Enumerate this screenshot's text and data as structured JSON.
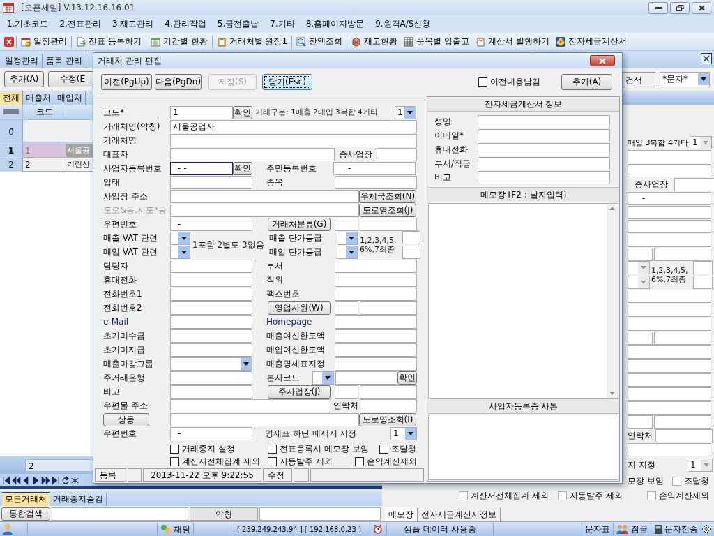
{
  "app": {
    "title": "[오픈세일] V.13.12.16.16.01"
  },
  "menu": [
    "1.기초코드",
    "2.전표관리",
    "3.재고관리",
    "4.관리작업",
    "5.금전출납",
    "7.기타",
    "8.홈페이지방문",
    "9.원격A/S신청"
  ],
  "toolbar": [
    "일정관리",
    "전표 등록하기",
    "기간별 현황",
    "거래처별 원장1",
    "잔액조회",
    "재고현황",
    "품목별 입출고",
    "계산서 발행하기",
    "전자세금계산서"
  ],
  "doc_tabs": [
    {
      "label": "일정관리",
      "selected": false
    },
    {
      "label": "품목 관리",
      "selected": false
    }
  ],
  "actions": {
    "buttons": [
      "추가(A)",
      "수정(E"
    ],
    "search_label": "검색",
    "search_mode": "*문자*"
  },
  "list": {
    "tabs": [
      {
        "label": "전체",
        "selected": true
      },
      {
        "label": "매출처",
        "selected": false
      },
      {
        "label": "매입처",
        "selected": false
      }
    ],
    "columns": [
      "코드"
    ],
    "filter_row": "0",
    "rows": [
      {
        "num": "1",
        "code": "1",
        "name": "서울공",
        "selected": true
      },
      {
        "num": "2",
        "code": "2",
        "name": "기린산",
        "selected": false
      }
    ],
    "footer_count": "2"
  },
  "bottom_tabs": [
    {
      "label": "모든거래처",
      "selected": true
    },
    {
      "label": "거래중지숨김",
      "selected": false
    }
  ],
  "search": {
    "button": "통합검색",
    "label": "약칭"
  },
  "detail": {
    "trade_type_note": "매입 3복합 4기타",
    "trade_type": "1",
    "branch_label": "종사업장",
    "resident_no": "-",
    "grade_note": "1,2,3,4,5, 6%,7최종",
    "contact_label": "연락처",
    "message_label": "지 지정",
    "message_value": "1",
    "memo_visible_text": "모장 보임",
    "checkboxes": [
      {
        "label": "조달청",
        "checked": false
      },
      {
        "label": "계산서전체집계 제외",
        "checked": false
      },
      {
        "label": "자동발주 제외",
        "checked": false
      },
      {
        "label": "손익계산제외",
        "checked": false
      }
    ],
    "tabs": [
      {
        "label": "메모장",
        "selected": true
      },
      {
        "label": "전자세금계산서정보",
        "selected": false
      }
    ]
  },
  "status_bar": {
    "chat": "채팅",
    "ip": "[ 239.249.243.94 ] [ 192.168.0.23 ]",
    "notice": "샘플 데이터 사용중",
    "buttons": [
      "문자표",
      "잠금",
      "문자전송"
    ]
  },
  "dialog": {
    "title": "거래처 관리 편집",
    "buttons": [
      {
        "label": "이전(PgUp)",
        "disabled": false,
        "focused": false
      },
      {
        "label": "다음(PgDn)",
        "disabled": false,
        "focused": false
      },
      {
        "label": "저장(S)",
        "disabled": true,
        "focused": false
      },
      {
        "label": "닫기(Esc)",
        "disabled": false,
        "focused": true
      }
    ],
    "keep_previous": {
      "label": "이전내용남김",
      "checked": false
    },
    "add_button": "추가(A)",
    "form": {
      "code": {
        "label": "코드*",
        "value": "1",
        "button": "확인"
      },
      "trade_type": {
        "label": "거래구분: 1매출 2매입 3복합 4기타",
        "value": "1"
      },
      "short_name": {
        "label": "거래처명(약칭)",
        "value": "서울공업사"
      },
      "name": {
        "label": "거래처명"
      },
      "ceo": {
        "label": "대표자"
      },
      "branch": {
        "label": "종사업장"
      },
      "biz_no": {
        "label": "사업자등록번호",
        "value": "- -",
        "button": "확인",
        "focused": true
      },
      "resident_no": {
        "label": "주민등록번호",
        "value": "-"
      },
      "biz_type": {
        "label": "업태"
      },
      "item": {
        "label": "종목"
      },
      "address": {
        "label": "사업장 주소",
        "button": "우체국조회(N)"
      },
      "road": {
        "label": "도로&동,시도*동",
        "button": "도로명조회(J)"
      },
      "zip": {
        "label": "우편번호",
        "value": "-"
      },
      "category_button": "거래처분류(G)",
      "sales_vat": {
        "label": "매출 VAT 관련"
      },
      "purchase_vat": {
        "label": "매입 VAT 관련"
      },
      "vat_note": "1포함 2별도 3없음",
      "sales_grade": {
        "label": "매출 단가등급"
      },
      "purchase_grade": {
        "label": "매입 단가등급"
      },
      "grade_note": "1,2,3,4,5, 6%,7최종",
      "contact": {
        "label": "담당자"
      },
      "dept": {
        "label": "부서"
      },
      "mobile": {
        "label": "휴대전화"
      },
      "position": {
        "label": "직위"
      },
      "phone1": {
        "label": "전화번호1"
      },
      "fax": {
        "label": "팩스번호"
      },
      "phone2": {
        "label": "전화번호2"
      },
      "sales_rep_button": "영업사원(W)",
      "email": {
        "label": "e-Mail"
      },
      "homepage": {
        "label": "Homepage"
      },
      "receivable": {
        "label": "초기미수금"
      },
      "sales_credit": {
        "label": "매출여신한도액"
      },
      "payable": {
        "label": "초기미지급"
      },
      "purchase_credit": {
        "label": "매입여신한도액"
      },
      "closing_group": {
        "label": "매출마감그룹"
      },
      "statement": {
        "label": "매출명세표지정"
      },
      "bank": {
        "label": "주거래은행"
      },
      "hq_code": {
        "label": "본사코드",
        "button": "확인"
      },
      "memo": {
        "label": "비고"
      },
      "main_branch_button": "주사업장(J)",
      "mail_address": {
        "label": "우편물 주소"
      },
      "mail_contact": {
        "label": "연락처"
      },
      "same_button": "상동",
      "mail_road_button": "도로명조회(I)",
      "mail_zip": {
        "label": "우편번호",
        "value": "-"
      },
      "footer_message": {
        "label": "명세표 하단 메세지 지정",
        "value": "1"
      }
    },
    "checkboxes": [
      {
        "label": "거래중지 설정",
        "checked": false
      },
      {
        "label": "전표등록시 메모장 보임",
        "checked": false
      },
      {
        "label": "조달청",
        "checked": false
      },
      {
        "label": "계산서전체집계 제외",
        "checked": false
      },
      {
        "label": "자동발주 제외",
        "checked": false
      },
      {
        "label": "손익계산제외",
        "checked": false
      }
    ],
    "status": {
      "mode": "등록",
      "timestamp": "2013-11-22 오후 9:22:55",
      "action": "수정"
    },
    "tax_invoice": {
      "title": "전자세금계산서 정보",
      "fields": [
        "성명",
        "이메일*",
        "휴대전화",
        "부서/직급",
        "비고"
      ]
    },
    "memo_title": "메모장 [F2 : 날자입력]",
    "license_title": "사업자등록증 사본"
  }
}
